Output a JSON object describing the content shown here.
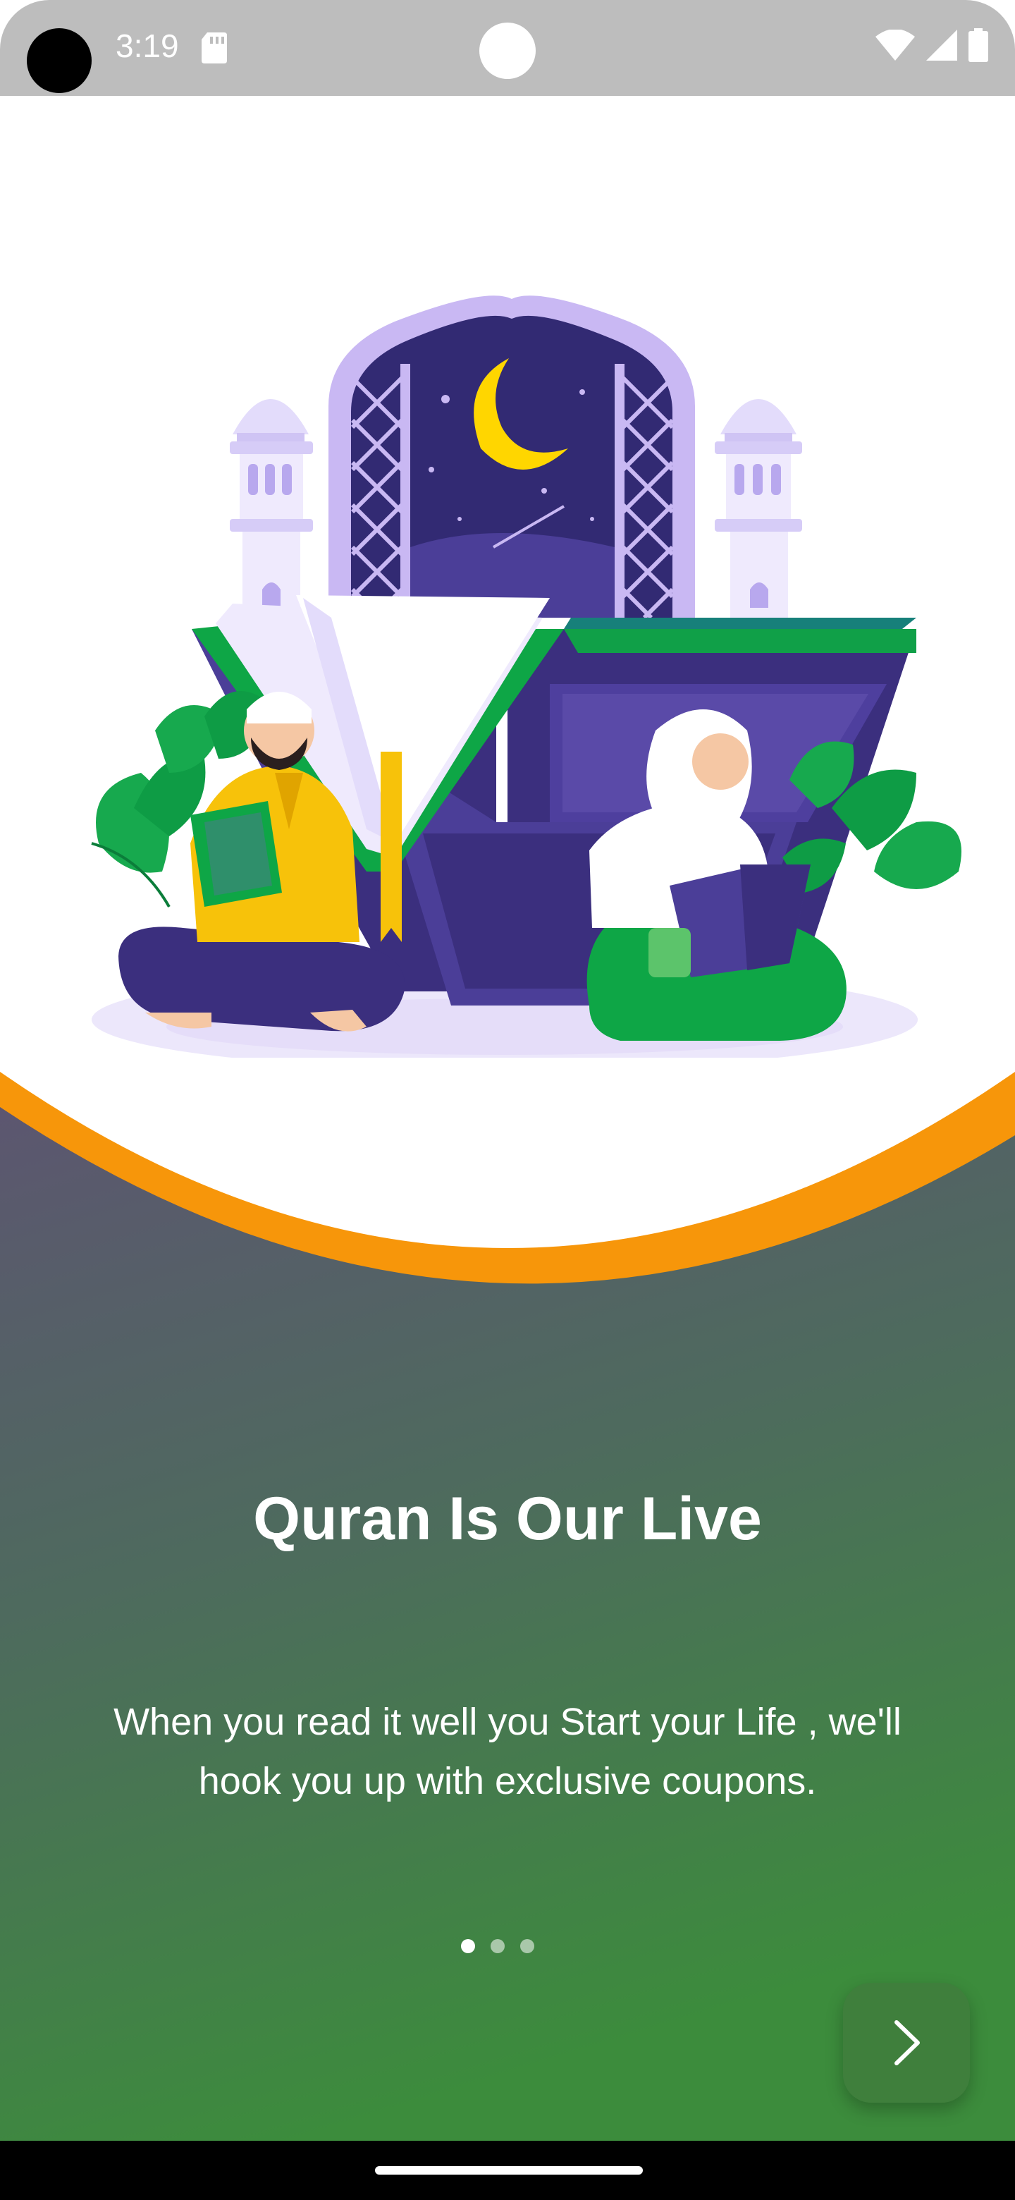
{
  "status_bar": {
    "time": "3:19",
    "icons": [
      "sd-card-icon",
      "wifi-icon",
      "signal-icon",
      "battery-icon"
    ]
  },
  "onboarding": {
    "title": "Quran Is Our Live",
    "description": "When you read it well you Start your Life , we'll hook you up with exclusive coupons.",
    "page_indicator": {
      "total": 3,
      "active_index": 0
    },
    "next_icon": "chevron-right-icon"
  },
  "colors": {
    "gradient_top": "#5c5670",
    "gradient_bottom": "#3c8c3c",
    "accent_orange": "#f7960a",
    "status_bar_bg": "#bdbdbd",
    "next_button_bg": "#3f7f3c"
  },
  "illustration": "mosque-quran-readers-illustration"
}
